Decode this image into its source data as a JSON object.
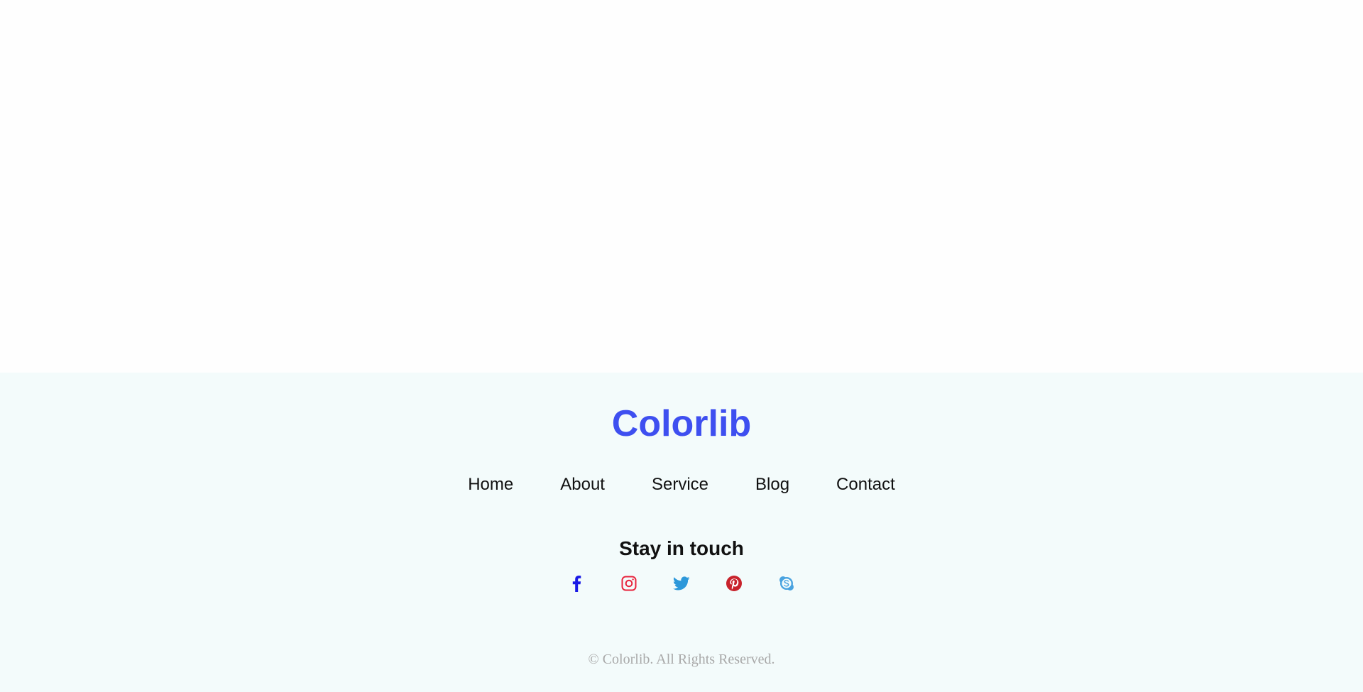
{
  "footer": {
    "brand": "Colorlib",
    "nav": [
      "Home",
      "About",
      "Service",
      "Blog",
      "Contact"
    ],
    "social_heading": "Stay in touch",
    "social": [
      {
        "icon": "facebook-icon",
        "color": "#1a1ae6"
      },
      {
        "icon": "instagram-icon",
        "color": "#e8223b"
      },
      {
        "icon": "twitter-icon",
        "color": "#2d98da"
      },
      {
        "icon": "pinterest-icon",
        "color": "#c8232c"
      },
      {
        "icon": "skype-icon",
        "color": "#4aa3e0"
      }
    ],
    "copyright": "© Colorlib. All Rights Reserved."
  },
  "colors": {
    "brand": "#3e4ff0",
    "footer_bg": "#f3fbfb"
  }
}
